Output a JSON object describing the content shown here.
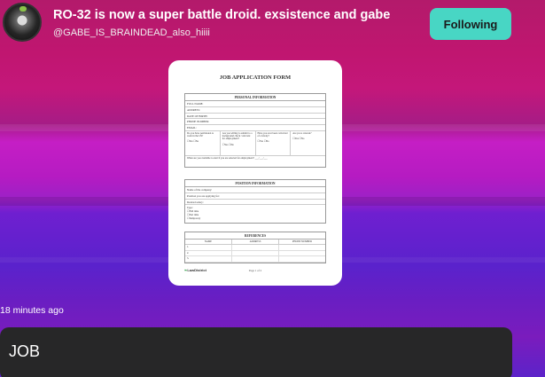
{
  "header": {
    "title": "RO-32 is now a super battle droid. exsistence and gabe",
    "handle": "@GABE_IS_BRAINDEAD_also_hiiii",
    "follow_label": "Following",
    "avatar_icon": "avatar-image"
  },
  "document": {
    "title": "JOB APPLICATION FORM",
    "personal": {
      "heading": "PERSONAL INFORMATION",
      "fields": [
        "FULL NAME:",
        "ADDRESS:",
        "DATE OF BIRTH:",
        "PHONE NUMBER:",
        "EMAIL:"
      ],
      "questions": [
        {
          "text": "Do you have permission to work in the US?",
          "options": "☐Yes ☐No"
        },
        {
          "text": "Are you willing to submit to a background check / relevant for employment?",
          "options": "☐Yes ☐No"
        },
        {
          "text": "Have you ever been convicted of a felony?",
          "options": "☐Yes ☐No"
        },
        {
          "text": "Are you a veteran?",
          "options": "☐Yes ☐No"
        }
      ],
      "availability": "When are you available to start if you are selected for employment? ___/___/___"
    },
    "position": {
      "heading": "POSITION INFORMATION",
      "fields": [
        "Name of the company:",
        "Position you are applying for:",
        "Desired salary:"
      ],
      "type_label": "Type:",
      "type_options": [
        "☐Full time",
        "☐Part time",
        "☐Temporary"
      ]
    },
    "references": {
      "heading": "REFERENCES",
      "columns": [
        "NAME",
        "ADDRESS",
        "PHONE NUMBER"
      ],
      "rows": [
        "1.",
        "2.",
        "3."
      ]
    },
    "logo_text": "LawDistrict",
    "page_label": "Page 1 of 2"
  },
  "post": {
    "timestamp": "18 minutes ago",
    "caption": "JOB"
  },
  "colors": {
    "follow_button": "#48d6c4",
    "caption_bg": "#272728"
  }
}
